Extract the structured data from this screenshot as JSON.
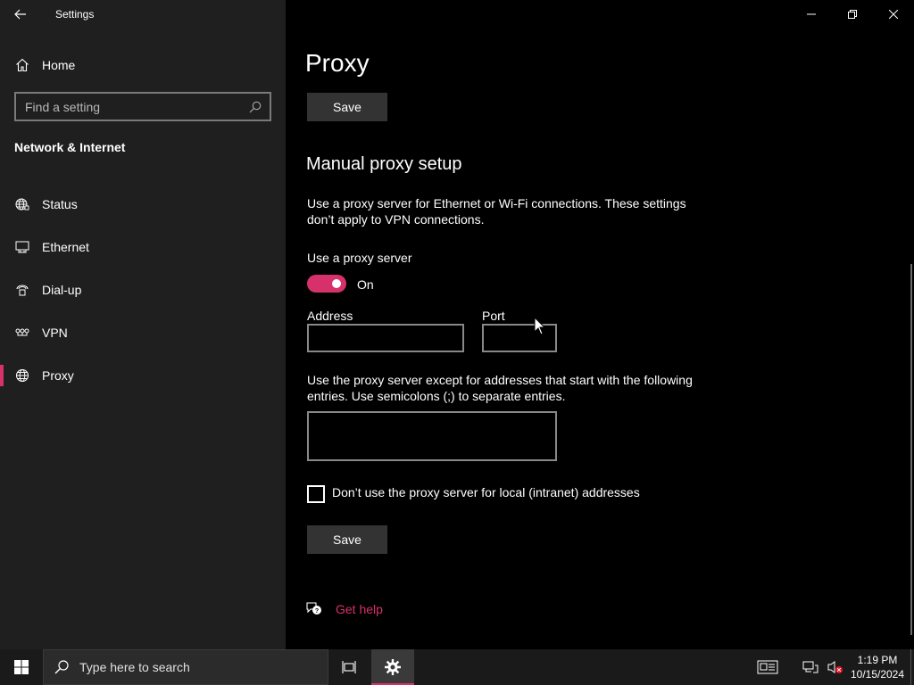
{
  "window": {
    "title": "Settings",
    "controls": [
      "minimize",
      "restore",
      "close"
    ]
  },
  "sidebar": {
    "home_label": "Home",
    "search_placeholder": "Find a setting",
    "section_title": "Network & Internet",
    "items": [
      {
        "label": "Status",
        "icon": "globe-status-icon",
        "selected": false
      },
      {
        "label": "Ethernet",
        "icon": "ethernet-icon",
        "selected": false
      },
      {
        "label": "Dial-up",
        "icon": "dialup-icon",
        "selected": false
      },
      {
        "label": "VPN",
        "icon": "vpn-icon",
        "selected": false
      },
      {
        "label": "Proxy",
        "icon": "globe-icon",
        "selected": true
      }
    ]
  },
  "main": {
    "page_title": "Proxy",
    "save_label": "Save",
    "manual_title": "Manual proxy setup",
    "manual_desc": "Use a proxy server for Ethernet or Wi-Fi connections. These settings don’t apply to VPN connections.",
    "use_proxy_label": "Use a proxy server",
    "toggle_state": "On",
    "address_label": "Address",
    "address_value": "",
    "port_label": "Port",
    "port_value": "",
    "exceptions_desc": "Use the proxy server except for addresses that start with the following entries. Use semicolons (;) to separate entries.",
    "exceptions_value": "",
    "bypass_local_label": "Don’t use the proxy server for local (intranet) addresses",
    "bypass_local_checked": false,
    "save_bottom_label": "Save",
    "help_label": "Get help"
  },
  "taskbar": {
    "search_placeholder": "Type here to search",
    "time": "1:19 PM",
    "date": "10/15/2024"
  },
  "colors": {
    "accent": "#d6316a",
    "sidebar_bg": "#1f1f1f",
    "content_bg": "#000000",
    "button_bg": "#333333"
  }
}
